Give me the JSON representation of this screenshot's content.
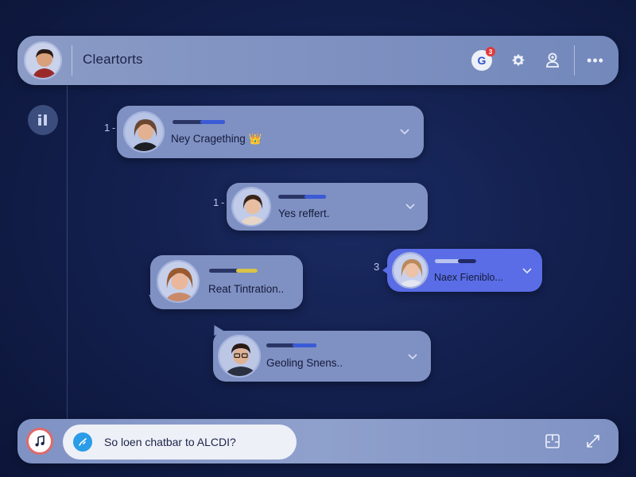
{
  "header": {
    "title": "Cleartorts",
    "notification_count": "3",
    "g_letter": "G",
    "more_icon": "•••"
  },
  "messages": [
    {
      "number": "1",
      "text": "Ney Cragething 👑",
      "progress": 0.47,
      "bar_color": "#3b5bd6",
      "avatar": "woman-long-hair",
      "active": false
    },
    {
      "number": "1",
      "text": "Yes reffert.",
      "progress": 0.45,
      "bar_color": "#3b5bd6",
      "avatar": "woman-short-hair",
      "active": false
    },
    {
      "number": "",
      "text": "Reat Tintration..",
      "progress": 0.45,
      "bar_color": "#d8c24a",
      "avatar": "woman-smiling",
      "active": false
    },
    {
      "number": "3",
      "text": "Naex Fieniblo...",
      "progress": 0.45,
      "bar_color": "#1f2a66",
      "avatar": "woman-blonde",
      "active": true
    },
    {
      "number": "",
      "text": "Geoling Snens..",
      "progress": 0.48,
      "bar_color": "#3b5bd6",
      "avatar": "man-glasses",
      "active": false
    }
  ],
  "composer": {
    "prompt_text": "So loen chatbar to ALCDI?"
  },
  "colors": {
    "accent": "#5a6de6",
    "card": "#7f90c3",
    "background": "#13204e"
  }
}
